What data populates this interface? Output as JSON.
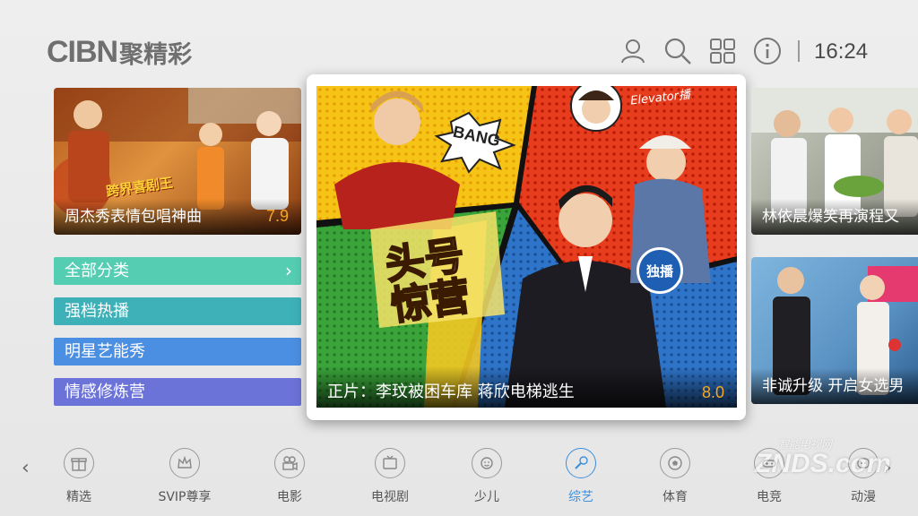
{
  "app": {
    "logo_latin": "CIBN",
    "logo_cn": "聚精彩",
    "time": "16:24",
    "header_icons": [
      "user-icon",
      "search-icon",
      "grid-icon",
      "info-icon"
    ]
  },
  "tiles": {
    "left_top": {
      "title": "周杰秀表情包唱神曲",
      "score": "7.9",
      "badge": "跨界喜剧王"
    },
    "featured": {
      "title": "正片：李玟被困车库 蒋欣电梯逃生",
      "score": "8.0",
      "badge": "独播",
      "show_logo": "头号惊营",
      "bang": "BANG",
      "elevator": "Elevator播"
    },
    "right_top": {
      "title": "林依晨爆笑再演程又"
    },
    "right_bottom": {
      "title": "非诚升级 开启女选男"
    }
  },
  "categories": [
    {
      "label": "全部分类",
      "color": "#54cdb3"
    },
    {
      "label": "强档热播",
      "color": "#3db1b7"
    },
    {
      "label": "明星艺能秀",
      "color": "#4b8fe2"
    },
    {
      "label": "情感修炼营",
      "color": "#6b72d8"
    }
  ],
  "nav": {
    "active_index": 5,
    "items": [
      {
        "label": "精选",
        "icon": "gift-icon"
      },
      {
        "label": "SVIP尊享",
        "icon": "crown-icon"
      },
      {
        "label": "电影",
        "icon": "movie-camera-icon"
      },
      {
        "label": "电视剧",
        "icon": "tv-icon"
      },
      {
        "label": "少儿",
        "icon": "child-icon"
      },
      {
        "label": "综艺",
        "icon": "microphone-icon"
      },
      {
        "label": "体育",
        "icon": "football-icon"
      },
      {
        "label": "电竞",
        "icon": "gamepad-icon"
      },
      {
        "label": "动漫",
        "icon": "anime-icon"
      }
    ]
  },
  "watermark": {
    "top": "智能电视网",
    "main": "ZNDS.com"
  },
  "colors": {
    "accent": "#3b8fdc",
    "score": "#f5a623"
  }
}
